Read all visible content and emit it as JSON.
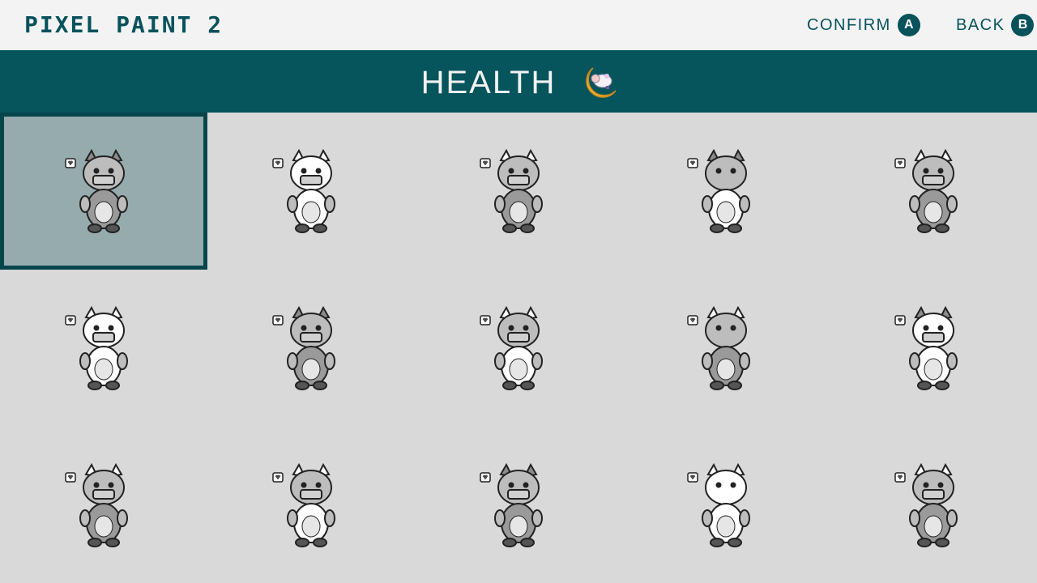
{
  "app": {
    "title": "PIXEL PAINT 2"
  },
  "controls": {
    "confirm": {
      "label": "CONFIRM",
      "button": "A"
    },
    "back": {
      "label": "BACK",
      "button": "B"
    }
  },
  "category": {
    "title": "HEALTH",
    "icon": "moon-sheep-icon"
  },
  "colors": {
    "accent": "#06545c",
    "background": "#d9d9d9",
    "selected_bg": "#96abad",
    "selected_border": "#06454c"
  },
  "selected_index": 0,
  "pictures": [
    {
      "icon": "shiba-iv-drip-icon"
    },
    {
      "icon": "panda-mask-icon"
    },
    {
      "icon": "giraffe-mask-icon"
    },
    {
      "icon": "sheep-moon-icon"
    },
    {
      "icon": "cat-box-icon"
    },
    {
      "icon": "cow-stethoscope-icon"
    },
    {
      "icon": "calico-cat-mask-icon"
    },
    {
      "icon": "panda-cart-icon"
    },
    {
      "icon": "lion-mask-icon"
    },
    {
      "icon": "bee-mask-icon"
    },
    {
      "icon": "sloth-bottle-icon"
    },
    {
      "icon": "unicorn-mask-icon"
    },
    {
      "icon": "shiba-bone-icon"
    },
    {
      "icon": "baby-balloons-icon"
    },
    {
      "icon": "shiba-mask-icon"
    }
  ]
}
